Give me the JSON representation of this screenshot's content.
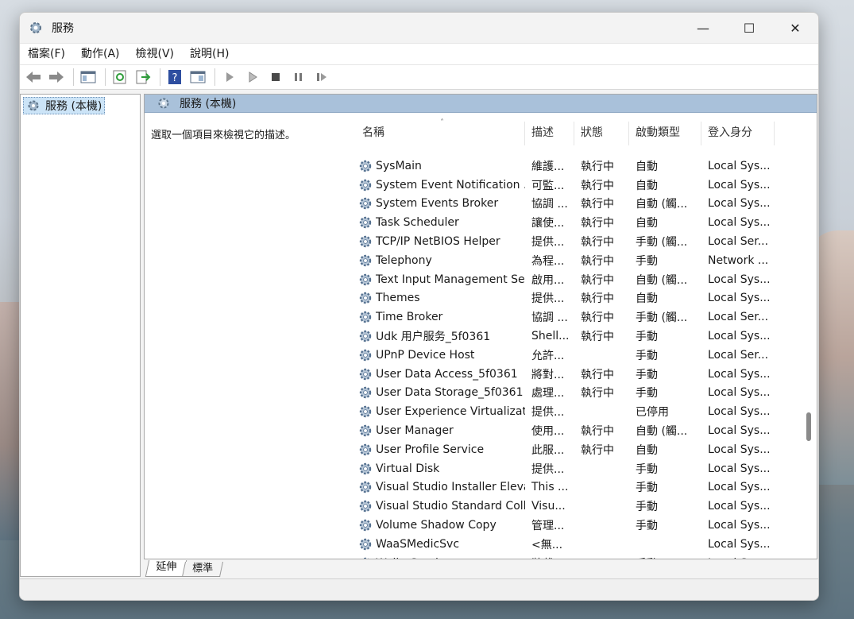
{
  "window": {
    "title": "服務"
  },
  "menu": [
    "檔案(F)",
    "動作(A)",
    "檢視(V)",
    "說明(H)"
  ],
  "tree": {
    "root_label": "服務 (本機)"
  },
  "main": {
    "header": "服務 (本機)",
    "description_hint": "選取一個項目來檢視它的描述。"
  },
  "columns": {
    "name": "名稱",
    "desc": "描述",
    "status": "狀態",
    "startup": "啟動類型",
    "logon": "登入身分"
  },
  "services": [
    {
      "name": "SysMain",
      "desc": "維護...",
      "status": "執行中",
      "startup": "自動",
      "logon": "Local Sys..."
    },
    {
      "name": "System Event Notification ...",
      "desc": "可監...",
      "status": "執行中",
      "startup": "自動",
      "logon": "Local Sys..."
    },
    {
      "name": "System Events Broker",
      "desc": "協調 ...",
      "status": "執行中",
      "startup": "自動 (觸...",
      "logon": "Local Sys..."
    },
    {
      "name": "Task Scheduler",
      "desc": "讓使...",
      "status": "執行中",
      "startup": "自動",
      "logon": "Local Sys..."
    },
    {
      "name": "TCP/IP NetBIOS Helper",
      "desc": "提供...",
      "status": "執行中",
      "startup": "手動 (觸...",
      "logon": "Local Ser..."
    },
    {
      "name": "Telephony",
      "desc": "為程...",
      "status": "執行中",
      "startup": "手動",
      "logon": "Network ..."
    },
    {
      "name": "Text Input Management Se...",
      "desc": "啟用...",
      "status": "執行中",
      "startup": "自動 (觸...",
      "logon": "Local Sys..."
    },
    {
      "name": "Themes",
      "desc": "提供...",
      "status": "執行中",
      "startup": "自動",
      "logon": "Local Sys..."
    },
    {
      "name": "Time Broker",
      "desc": "協調 ...",
      "status": "執行中",
      "startup": "手動 (觸...",
      "logon": "Local Ser..."
    },
    {
      "name": "Udk 用户服务_5f0361",
      "desc": "Shell...",
      "status": "執行中",
      "startup": "手動",
      "logon": "Local Sys..."
    },
    {
      "name": "UPnP Device Host",
      "desc": "允許...",
      "status": "",
      "startup": "手動",
      "logon": "Local Ser..."
    },
    {
      "name": "User Data Access_5f0361",
      "desc": "將對...",
      "status": "執行中",
      "startup": "手動",
      "logon": "Local Sys..."
    },
    {
      "name": "User Data Storage_5f0361",
      "desc": "處理...",
      "status": "執行中",
      "startup": "手動",
      "logon": "Local Sys..."
    },
    {
      "name": "User Experience Virtualizat...",
      "desc": "提供...",
      "status": "",
      "startup": "已停用",
      "logon": "Local Sys..."
    },
    {
      "name": "User Manager",
      "desc": "使用...",
      "status": "執行中",
      "startup": "自動 (觸...",
      "logon": "Local Sys..."
    },
    {
      "name": "User Profile Service",
      "desc": "此服...",
      "status": "執行中",
      "startup": "自動",
      "logon": "Local Sys..."
    },
    {
      "name": "Virtual Disk",
      "desc": "提供...",
      "status": "",
      "startup": "手動",
      "logon": "Local Sys..."
    },
    {
      "name": "Visual Studio Installer Eleva...",
      "desc": "This ...",
      "status": "",
      "startup": "手動",
      "logon": "Local Sys..."
    },
    {
      "name": "Visual Studio Standard Coll...",
      "desc": "Visu...",
      "status": "",
      "startup": "手動",
      "logon": "Local Sys..."
    },
    {
      "name": "Volume Shadow Copy",
      "desc": "管理...",
      "status": "",
      "startup": "手動",
      "logon": "Local Sys..."
    },
    {
      "name": "WaaSMedicSvc",
      "desc": "<無...",
      "status": "",
      "startup": "",
      "logon": "Local Sys..."
    },
    {
      "name": "WalletService",
      "desc": "裝載...",
      "status": "",
      "startup": "手動",
      "logon": "Local Sys..."
    }
  ],
  "tabs": [
    "延伸",
    "標準"
  ],
  "colors": {
    "header_band": "#a9c1da",
    "selected_node": "#cce4f7"
  }
}
